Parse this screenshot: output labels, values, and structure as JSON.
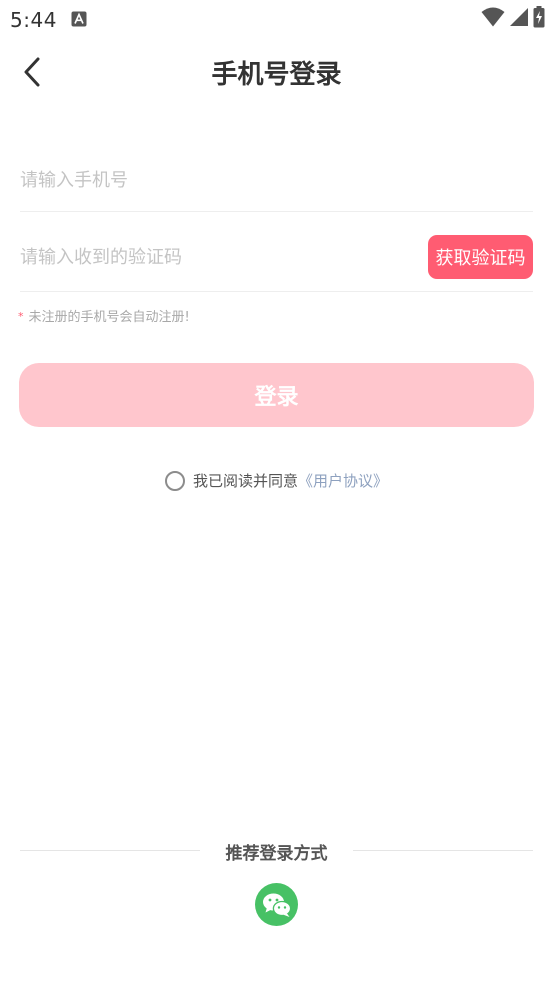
{
  "status_bar": {
    "time": "5:44",
    "notification_icon": "a-icon",
    "icons": [
      "wifi-icon",
      "signal-icon",
      "battery-charging-icon"
    ]
  },
  "header": {
    "title": "手机号登录",
    "back_icon": "chevron-left-icon"
  },
  "form": {
    "phone": {
      "placeholder": "请输入手机号",
      "value": ""
    },
    "code": {
      "placeholder": "请输入收到的验证码",
      "value": ""
    },
    "get_code_label": "获取验证码",
    "tip_mark": "*",
    "tip": "未注册的手机号会自动注册!",
    "login_label": "登录"
  },
  "agreement": {
    "text": "我已阅读并同意",
    "link": "《用户协议》",
    "checked": false
  },
  "social": {
    "title": "推荐登录方式",
    "methods": [
      "wechat-icon"
    ]
  },
  "colors": {
    "accent": "#ff5c72",
    "login_disabled": "#ffc6cd",
    "link": "#8ea1bf",
    "wechat": "#47c165",
    "placeholder": "#c4c4c4"
  }
}
